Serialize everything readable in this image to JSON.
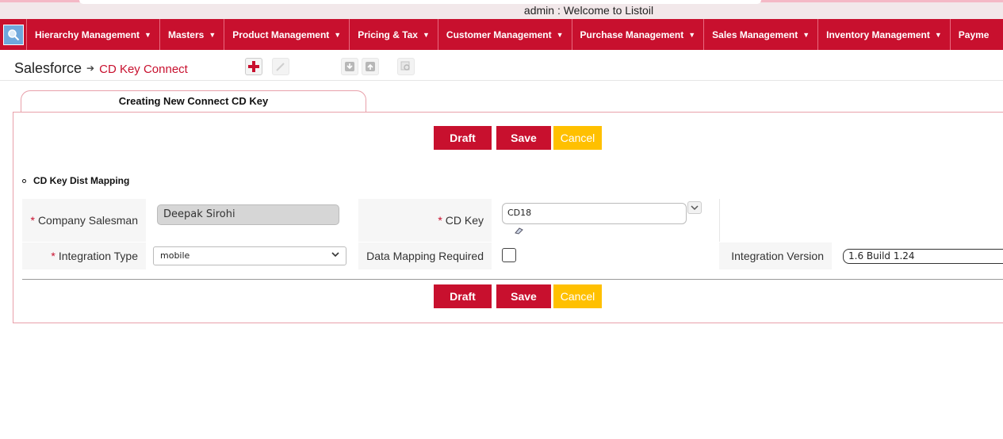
{
  "header": {
    "welcome": "admin : Welcome to Listoil"
  },
  "nav": {
    "search_icon": "search-icon",
    "items": [
      {
        "label": "Hierarchy Management"
      },
      {
        "label": "Masters"
      },
      {
        "label": "Product Management"
      },
      {
        "label": "Pricing & Tax"
      },
      {
        "label": "Customer Management"
      },
      {
        "label": "Purchase Management"
      },
      {
        "label": "Sales Management"
      },
      {
        "label": "Inventory Management"
      },
      {
        "label": "Payme"
      }
    ]
  },
  "breadcrumb": {
    "root": "Salesforce",
    "leaf": "CD Key Connect"
  },
  "tab": {
    "title": "Creating New Connect CD Key"
  },
  "buttons": {
    "draft": "Draft",
    "save": "Save",
    "cancel": "Cancel"
  },
  "section": {
    "title": "CD Key Dist Mapping"
  },
  "form": {
    "company_salesman": {
      "label": "Company Salesman",
      "value": "Deepak Sirohi"
    },
    "cd_key": {
      "label": "CD Key",
      "value": "CD18"
    },
    "integration_type": {
      "label": "Integration Type",
      "value": "mobile"
    },
    "data_mapping": {
      "label": "Data Mapping Required"
    },
    "integration_version": {
      "label": "Integration Version",
      "value": "1.6 Build 1.24"
    }
  },
  "colors": {
    "brand": "#c8102e",
    "cancel": "#ffc000"
  }
}
